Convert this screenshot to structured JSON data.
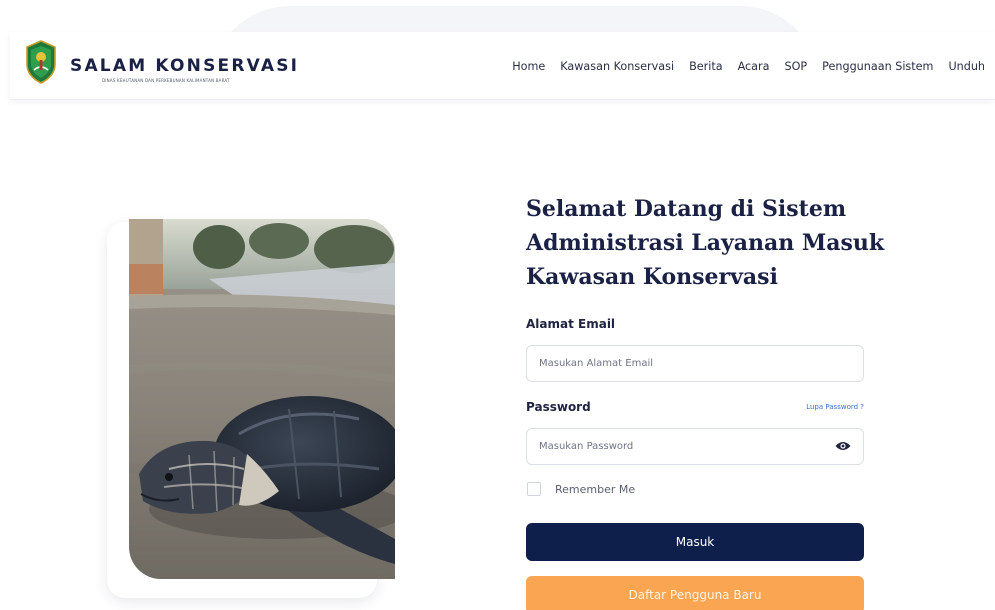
{
  "brand": {
    "title": "SALAM KONSERVASI",
    "subtitle": "DINAS KEHUTANAN DAN PERKEBUNAN KALIMANTAN BARAT",
    "logo_icon": "provincial-shield-logo"
  },
  "nav": {
    "items": [
      {
        "label": "Home"
      },
      {
        "label": "Kawasan Konservasi"
      },
      {
        "label": "Berita"
      },
      {
        "label": "Acara"
      },
      {
        "label": "SOP"
      },
      {
        "label": "Penggunaan Sistem"
      },
      {
        "label": "Unduh"
      }
    ]
  },
  "hero": {
    "image_icon": "sea-turtle-photo"
  },
  "form": {
    "title": "Selamat Datang di Sistem Administrasi Layanan Masuk Kawasan Konservasi",
    "email_label": "Alamat Email",
    "email_placeholder": "Masukan Alamat Email",
    "email_value": "",
    "password_label": "Password",
    "forgot_label": "Lupa Password ?",
    "password_placeholder": "Masukan Password",
    "password_value": "",
    "password_toggle_icon": "eye-icon",
    "remember_label": "Remember Me",
    "remember_checked": false,
    "login_label": "Masuk",
    "register_label": "Daftar Pengguna Baru"
  },
  "colors": {
    "primary": "#0f1f4c",
    "accent": "#f9a552",
    "link": "#3d6fd1"
  }
}
